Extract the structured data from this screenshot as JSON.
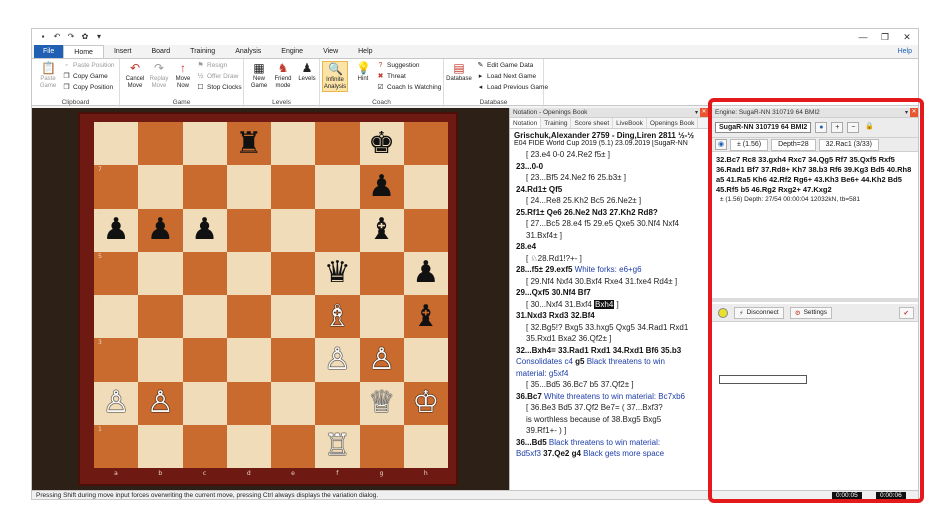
{
  "window": {
    "title": "",
    "quick_access": [
      "disk-icon",
      "undo-icon",
      "redo-icon",
      "tools-icon",
      "dropdown-icon"
    ],
    "controls": {
      "minimize": "—",
      "maximize": "❐",
      "close": "✕"
    }
  },
  "menu": {
    "file": "File",
    "tabs": [
      "Home",
      "Insert",
      "Board",
      "Training",
      "Analysis",
      "Engine",
      "View",
      "Help"
    ],
    "active": "Home",
    "help_link": "Help"
  },
  "ribbon": {
    "clipboard": {
      "label": "Clipboard",
      "paste_game": "Paste Game",
      "paste_position": "Paste Position",
      "copy_game": "Copy Game",
      "copy_position": "Copy Position"
    },
    "game": {
      "label": "Game",
      "cancel_move": "Cancel Move",
      "replay_move": "Replay Move",
      "move_now": "Move Now",
      "resign": "Resign",
      "offer_draw": "Offer Draw",
      "stop_clocks": "Stop Clocks"
    },
    "levels": {
      "label": "Levels",
      "new_game": "New Game",
      "friend_mode": "Friend mode",
      "levels": "Levels"
    },
    "coach": {
      "label": "Coach",
      "infinite_analysis": "Infinite Analysis",
      "hint": "Hint",
      "suggestion": "Suggestion",
      "threat": "Threat",
      "coach_is_watching": "Coach Is Watching"
    },
    "database": {
      "label": "Database",
      "database": "Database",
      "edit_game_data": "Edit Game Data",
      "load_next_game": "Load Next Game",
      "load_previous_game": "Load Previous Game"
    }
  },
  "board": {
    "files": [
      "a",
      "b",
      "c",
      "d",
      "e",
      "f",
      "g",
      "h"
    ],
    "ranks": [
      "8",
      "7",
      "6",
      "5",
      "4",
      "3",
      "2",
      "1"
    ],
    "position": [
      [
        "",
        "",
        "",
        "♜",
        "",
        "",
        "♚",
        ""
      ],
      [
        "",
        "",
        "",
        "",
        "",
        "",
        "♟",
        ""
      ],
      [
        "♟",
        "♟",
        "♟",
        "",
        "",
        "",
        "♝",
        ""
      ],
      [
        "",
        "",
        "",
        "",
        "",
        "♛",
        "",
        "♟"
      ],
      [
        "",
        "",
        "",
        "",
        "",
        "♗",
        "",
        "♝"
      ],
      [
        "",
        "",
        "",
        "",
        "",
        "♙",
        "♙",
        ""
      ],
      [
        "♙",
        "♙",
        "",
        "",
        "",
        "",
        "♕",
        "♔"
      ],
      [
        "",
        "",
        "",
        "",
        "",
        "♖",
        "",
        ""
      ]
    ],
    "white_pieces": [
      "♖",
      "♕",
      "♔",
      "♗",
      "♙"
    ]
  },
  "notation": {
    "pane_title": "Notation - Openings Book",
    "tabs": [
      "Notation",
      "Training",
      "Score sheet",
      "LiveBook",
      "Openings Book"
    ],
    "active_tab": "Notation",
    "header": "Grischuk,Alexander  2759 - Ding,Liren  2811  ½-½",
    "event": "E04 FIDE World Cup 2019 (5.1) 23.09.2019 [SugaR-NN",
    "lines": [
      {
        "type": "var",
        "text": "[ 23.e4  0-0  24.Re2  f5± ]"
      },
      {
        "type": "mv",
        "text": "23...0-0"
      },
      {
        "type": "var",
        "text": "[ 23...Bf5  24.Ne2  f6  25.b3± ]"
      },
      {
        "type": "mv",
        "text": "24.Rd1±  Qf5"
      },
      {
        "type": "var",
        "text": "[ 24...Re8  25.Kh2  Bc5  26.Ne2± ]"
      },
      {
        "type": "mv",
        "text": "25.Rf1±  Qe6  26.Ne2  Nd3  27.Kh2  Rd8?"
      },
      {
        "type": "var",
        "text": "[ 27...Bc5  28.e4  f5  29.e5  Qxe5  30.Nf4  Nxf4"
      },
      {
        "type": "var",
        "text": "31.Bxf4± ]"
      },
      {
        "type": "mv",
        "text": "28.e4"
      },
      {
        "type": "var",
        "text": "[ ♘28.Rd1!?+- ]"
      },
      {
        "type": "mixed",
        "mv": "28...f5±  29.exf5",
        "cmt": " White forks: e6+g6"
      },
      {
        "type": "var",
        "text": "[ 29.Nf4  Nxf4  30.Bxf4  Rxe4  31.fxe4  Rd4± ]"
      },
      {
        "type": "mv",
        "text": "29...Qxf5  30.Nf4  Bf7"
      },
      {
        "type": "varsel",
        "text": "[ 30...Nxf4  31.Bxf4  ",
        "sel": "Bxh4",
        "end": " ]"
      },
      {
        "type": "mv",
        "text": "31.Nxd3  Rxd3  32.Bf4"
      },
      {
        "type": "var",
        "text": "[ 32.Bg5!?  Bxg5  33.hxg5  Qxg5  34.Rad1  Rxd1"
      },
      {
        "type": "var",
        "text": "35.Rxd1  Bxa2  36.Qf2± ]"
      },
      {
        "type": "mv",
        "text": "32...Bxh4=  33.Rad1  Rxd1  34.Rxd1  Bf6  35.b3"
      },
      {
        "type": "cmtline",
        "pre": "Consolidates c4  ",
        "mv": "g5",
        "cmt": " Black threatens to win"
      },
      {
        "type": "cmtonly",
        "text": "material: g5xf4"
      },
      {
        "type": "var",
        "text": "[ 35...Bd5  36.Bc7  b5  37.Qf2± ]"
      },
      {
        "type": "mixed",
        "mv": "36.Bc7",
        "cmt": " White threatens to win material: Bc7xb6"
      },
      {
        "type": "var",
        "text": "[ 36.Be3  Bd5  37.Qf2  Be7=  ( 37...Bxf3?"
      },
      {
        "type": "var",
        "text": "is worthless because of  38.Bxg5  Bxg5"
      },
      {
        "type": "var",
        "text": "39.Rf1+- ) ]"
      },
      {
        "type": "mixed",
        "mv": "36...Bd5",
        "cmt": " Black threatens to win material:"
      },
      {
        "type": "mixed2",
        "cmt": "Bd5xf3  ",
        "mv": "37.Qe2  g4",
        "cmt2": " Black gets more space"
      }
    ]
  },
  "engine": {
    "pane_title": "Engine: SugaR-NN 310719 64 BMI2",
    "name": "SugaR-NN 310719 64 BMI2",
    "eval": "± (1.56)",
    "depth": "Depth=28",
    "best_move": "32.Rac1 (3/33)",
    "pv": "32.Bc7 Rc8 33.gxh4 Rxc7 34.Qg5 Rf7 35.Qxf5 Rxf5 36.Rad1 Bf7 37.Rd8+ Kh7 38.b3 Rf6 39.Kg3 Bd5 40.Rh8 a5 41.Ra5 Kh6 42.Rf2 Rg6+ 43.Kh3 Be6+ 44.Kh2 Bd5 45.Rf5 b5 46.Rg2 Rxg2+ 47.Kxg2",
    "stats": "± (1.56)   Depth: 27/54   00:00:04   12032kN, tb=581",
    "disconnect": "Disconnect",
    "settings": "Settings"
  },
  "status": {
    "text": "Pressing Shift during move input forces overwriting the current move, pressing Ctrl always displays the variation dialog.",
    "clock_white": "0:00:05",
    "clock_black": "0:00:06"
  },
  "colors": {
    "board_light": "#f0dcb8",
    "board_dark": "#c96a2e",
    "frame": "#6e1a12",
    "annotation": "#e3191c",
    "file_tab": "#1f5fb4",
    "comment_blue": "#1d3ea8"
  }
}
